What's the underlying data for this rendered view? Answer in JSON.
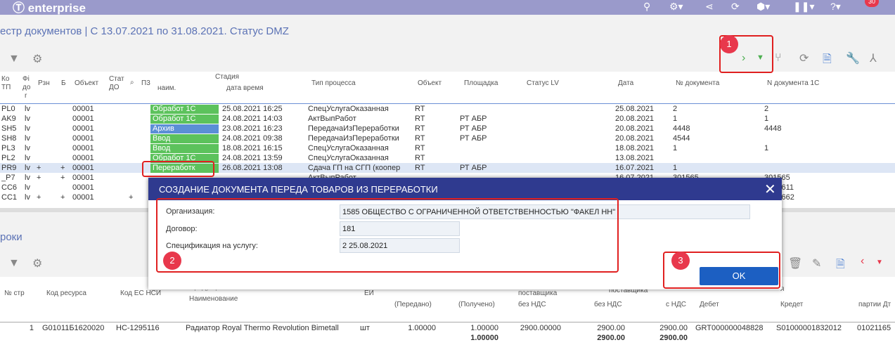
{
  "app": {
    "logo": "enterprise",
    "notif_count": "30"
  },
  "title": "естр документов | С 13.07.2021 по 31.08.2021. Статус DMZ",
  "upper_grid": {
    "headers": {
      "kod": "Ко",
      "tp": "ТП",
      "fi": "Фi",
      "do": "до",
      "r": "r",
      "rzn": "Рзн",
      "b": "Б",
      "obj": "Объект",
      "stat": "Стат",
      "stat2": "ДО",
      "p3": "П3",
      "stage": "Стадия",
      "naim": "наим.",
      "dt": "дата время",
      "tip": "Тип процесса",
      "obj2": "Объект",
      "plosh": "Площадка",
      "statuslv": "Статус LV",
      "date": "Дата",
      "ndoc": "№ документа",
      "ndoc1c": "N документа 1С"
    },
    "rows": [
      {
        "k": "PL0",
        "f": "lv",
        "r": "",
        "b": "",
        "o": "00001",
        "s": "",
        "stage": "Обработ 1С",
        "dt": "25.08.2021 16:25",
        "tip": "СпецУслугаОказанная",
        "ob": "RT",
        "pl": "",
        "date": "25.08.2021",
        "nd": "2",
        "n1": "2"
      },
      {
        "k": "AK9",
        "f": "lv",
        "r": "",
        "b": "",
        "o": "00001",
        "s": "",
        "stage": "Обработ 1С",
        "dt": "24.08.2021 14:03",
        "tip": "АктВыпРабот",
        "ob": "RT",
        "pl": "РТ АБР",
        "date": "20.08.2021",
        "nd": "1",
        "n1": "1"
      },
      {
        "k": "SH5",
        "f": "lv",
        "r": "",
        "b": "",
        "o": "00001",
        "s": "",
        "stage": "Архив",
        "dt": "23.08.2021 16:23",
        "tip": "ПередачаИзПереработки",
        "ob": "RT",
        "pl": "РТ АБР",
        "date": "20.08.2021",
        "nd": "4448",
        "n1": "4448"
      },
      {
        "k": "SH8",
        "f": "lv",
        "r": "",
        "b": "",
        "o": "00001",
        "s": "",
        "stage": "Ввод",
        "dt": "24.08.2021 09:38",
        "tip": "ПередачаИзПереработки",
        "ob": "RT",
        "pl": "РТ АБР",
        "date": "20.08.2021",
        "nd": "4544",
        "n1": ""
      },
      {
        "k": "PL3",
        "f": "lv",
        "r": "",
        "b": "",
        "o": "00001",
        "s": "",
        "stage": "Ввод",
        "dt": "18.08.2021 16:15",
        "tip": "СпецУслугаОказанная",
        "ob": "RT",
        "pl": "",
        "date": "18.08.2021",
        "nd": "1",
        "n1": "1"
      },
      {
        "k": "PL2",
        "f": "lv",
        "r": "",
        "b": "",
        "o": "00001",
        "s": "",
        "stage": "Обработ 1С",
        "dt": "24.08.2021 13:59",
        "tip": "СпецУслугаОказанная",
        "ob": "RT",
        "pl": "",
        "date": "13.08.2021",
        "nd": "",
        "n1": ""
      },
      {
        "k": "PR9",
        "f": "lv",
        "r": "+",
        "b": "+",
        "o": "00001",
        "s": "",
        "stage": "Переработк",
        "dt": "26.08.2021 13:08",
        "tip": "Сдача ГП на СГП (коопер",
        "ob": "RT",
        "pl": "РТ АБР",
        "date": "16.07.2021",
        "nd": "1",
        "n1": ""
      },
      {
        "k": "_P7",
        "f": "lv",
        "r": "+",
        "b": "+",
        "o": "00001",
        "s": "",
        "stage": "",
        "dt": "",
        "tip": "АктВыпРабот",
        "ob": "",
        "pl": "",
        "date": "16.07.2021",
        "nd": "301565",
        "n1": "301565"
      },
      {
        "k": "CC6",
        "f": "lv",
        "r": "",
        "b": "",
        "o": "00001",
        "s": "",
        "stage": "",
        "dt": "",
        "tip": "",
        "ob": "",
        "pl": "",
        "date": "",
        "nd": "",
        "n1": "0004611"
      },
      {
        "k": "CC1",
        "f": "lv",
        "r": "+",
        "b": "+",
        "o": "00001",
        "s": "+",
        "stage": "",
        "dt": "",
        "tip": "",
        "ob": "",
        "pl": "",
        "date": "",
        "nd": "",
        "n1": "0004662"
      }
    ]
  },
  "lower": {
    "title": "роки",
    "headers": {
      "nstr": "№ стр",
      "kodres": "Код ресурса",
      "kodes": "Код ЕС НСИ",
      "product": "Продукция",
      "naim": "Наименование",
      "ei": "ЕИ",
      "pered": "(Передано)",
      "poluch": "(Получено)",
      "post1": "поставщика",
      "bez1": "без НДС",
      "post2": "поставщика",
      "bez2": "без НДС",
      "snds": "с НДС",
      "debet": "Дебет",
      "kredit": "Кредет",
      "partii": "партии Дт",
      "ya": "я"
    },
    "row": {
      "n": "1",
      "kod": "G01011Б1620020",
      "es": "НС-1295116",
      "name": "Радиатор Royal Thermo Revolution Bimetall",
      "ei": "шт",
      "pered": "1.00000",
      "poluch": "1.00000",
      "c1": "2900.00000",
      "c2": "2900.00",
      "c3": "2900.00",
      "deb": "GRT000000048828",
      "kred": "S01000001832012",
      "part": "01021165"
    },
    "totals": {
      "poluch": "1.00000",
      "c2": "2900.00",
      "c3": "2900.00"
    }
  },
  "dialog": {
    "title": "СОЗДАНИЕ ДОКУМЕНТА ПЕРЕДА ТОВАРОВ ИЗ ПЕРЕРАБОТКИ",
    "org_label": "Организация:",
    "org_value": "1585 ОБЩЕСТВО С ОГРАНИЧЕННОЙ ОТВЕТСТВЕННОСТЬЮ \"ФАКЕЛ НН\"",
    "dog_label": "Договор:",
    "dog_value": "181",
    "spec_label": "Спецификация на услугу:",
    "spec_value": "2 25.08.2021",
    "ok": "OK"
  },
  "badges": {
    "b1": "1",
    "b2": "2",
    "b3": "3"
  },
  "colors": {
    "green": "#5cc25c",
    "blue": "#5b8fd6",
    "header": "#9a9acb",
    "dialog_header": "#2f3a8f",
    "accent": "#e02020",
    "ok": "#1c5fc2"
  }
}
